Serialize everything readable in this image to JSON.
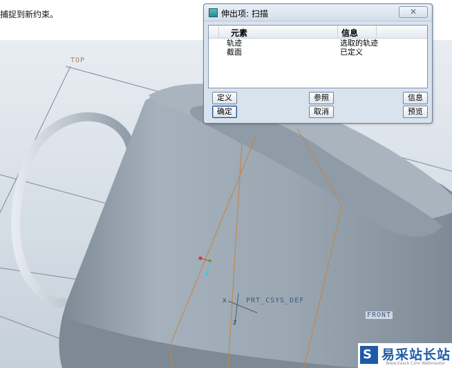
{
  "message_bar": {
    "text": "捕捉到新约束。"
  },
  "viewport": {
    "labels": {
      "top": "TOP",
      "csys": "PRT_CSYS_DEF",
      "front": "FRONT"
    },
    "colors": {
      "background": "#ffffff",
      "model": "#9aa7b3",
      "datum_plane": "#a0805a",
      "datum_line": "#d08a4a"
    }
  },
  "dialog": {
    "title": "伸出项: 扫描",
    "close_symbol": "✕",
    "table": {
      "headers": [
        "元素",
        "信息"
      ],
      "rows": [
        {
          "element": "轨迹",
          "info": "选取的轨迹"
        },
        {
          "element": "截面",
          "info": "已定义"
        }
      ]
    },
    "buttons": {
      "define": "定义",
      "references": "参照",
      "info": "信息",
      "ok": "确定",
      "cancel": "取消",
      "preview": "预览"
    }
  },
  "watermark": {
    "logo_char": "S",
    "text": "易采站长站",
    "url": "Www.Easck.Com Webmaster"
  }
}
